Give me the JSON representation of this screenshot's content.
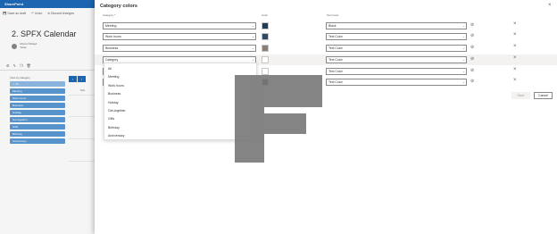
{
  "app": {
    "brand": "SharePoint"
  },
  "commands": [
    {
      "icon": "save-icon",
      "label": "Save as draft"
    },
    {
      "icon": "undo-icon",
      "label": "Undo"
    },
    {
      "icon": "discard-icon",
      "label": "Discard changes"
    }
  ],
  "page": {
    "title": "2. SPFX Calendar",
    "author_name": "Ahmet Özkaylı",
    "author_role": "Yazar"
  },
  "calendar": {
    "view_label": "View by category",
    "categories": [
      {
        "label": "All",
        "selected": true
      },
      {
        "label": "Meeting"
      },
      {
        "label": "Work hours"
      },
      {
        "label": "Business"
      },
      {
        "label": "Holiday"
      },
      {
        "label": "Get-together"
      },
      {
        "label": "Gifts"
      },
      {
        "label": "Birthday"
      },
      {
        "label": "Anniversary"
      }
    ],
    "prev": "‹",
    "next": "›",
    "day_header": "Sun"
  },
  "dialog": {
    "title": "Category colors",
    "close_glyph": "×",
    "col_category": "Category *",
    "col_color": "Color",
    "col_text_color": "Text Color",
    "rows": [
      {
        "category": "Meeting",
        "color": "#1f3b57",
        "text_color": "Black"
      },
      {
        "category": "Work hours",
        "color": "#2d4a66",
        "text_color": "Text Color"
      },
      {
        "category": "Business",
        "color": "#8a7f74",
        "text_color": "Text Color"
      },
      {
        "category": "Category",
        "color": "",
        "text_color": "Text Color",
        "highlight": true
      },
      {
        "category": "",
        "color": "",
        "text_color": "Text Color"
      },
      {
        "category": "",
        "color": "#1f3b57",
        "text_color": "Text Color"
      }
    ],
    "dropdown_options": [
      "All",
      "Meeting",
      "Work hours",
      "Business",
      "Holiday",
      "Get-together",
      "Gifts",
      "Birthday",
      "Anniversary"
    ],
    "save_label": "Save",
    "cancel_label": "Cancel"
  },
  "colors": {
    "brand": "#1e6ab8",
    "category_button": "#5b9bd5",
    "selected_category": "#8fbbe6",
    "watermark": "#7a7a7a"
  }
}
